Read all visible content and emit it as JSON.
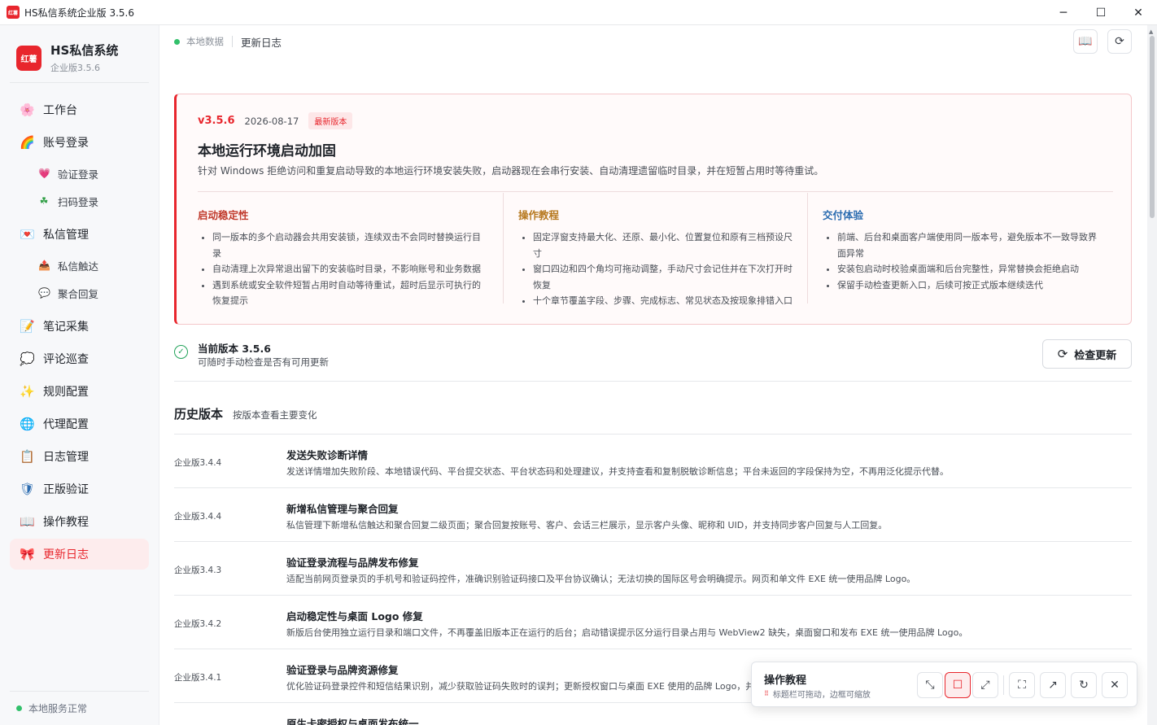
{
  "window": {
    "title": "HS私信系统企业版 3.5.6",
    "app_icon_text": "红薯",
    "minimize": "─",
    "maximize": "☐",
    "close": "✕"
  },
  "sidebar": {
    "brand_logo_text": "红薯",
    "brand_name": "HS私信系统",
    "brand_sub": "企业版3.5.6",
    "items": [
      {
        "label": "工作台",
        "icon": "🌸"
      },
      {
        "label": "账号登录",
        "icon": "🌈"
      },
      {
        "label": "验证登录",
        "icon": "💗"
      },
      {
        "label": "扫码登录",
        "icon": "☘"
      },
      {
        "label": "私信管理",
        "icon": "💌"
      },
      {
        "label": "私信触达",
        "icon": "📤"
      },
      {
        "label": "聚合回复",
        "icon": "💬"
      },
      {
        "label": "笔记采集",
        "icon": "📝"
      },
      {
        "label": "评论巡查",
        "icon": "💭"
      },
      {
        "label": "规则配置",
        "icon": "✨"
      },
      {
        "label": "代理配置",
        "icon": "🌐"
      },
      {
        "label": "日志管理",
        "icon": "📋"
      },
      {
        "label": "正版验证",
        "icon": "🛡"
      },
      {
        "label": "操作教程",
        "icon": "📖"
      },
      {
        "label": "更新日志",
        "icon": "🎀"
      }
    ],
    "footer_status": "本地服务正常"
  },
  "header": {
    "status": "本地数据",
    "breadcrumb": "更新日志",
    "btn_book_icon": "📖",
    "btn_refresh_icon": "⟳"
  },
  "release": {
    "version": "v3.5.6",
    "date": "2026-08-17",
    "badge": "最新版本",
    "title": "本地运行环境启动加固",
    "desc": "针对 Windows 拒绝访问和重复启动导致的本地运行环境安装失败，启动器现在会串行安装、自动清理遗留临时目录，并在短暂占用时等待重试。",
    "columns": [
      {
        "title": "启动稳定性",
        "color": "#c0392b",
        "items": [
          "同一版本的多个启动器会共用安装锁，连续双击不会同时替换运行目录",
          "自动清理上次异常退出留下的安装临时目录，不影响账号和业务数据",
          "遇到系统或安全软件短暂占用时自动等待重试，超时后显示可执行的恢复提示"
        ]
      },
      {
        "title": "操作教程",
        "color": "#b7791f",
        "items": [
          "固定浮窗支持最大化、还原、最小化、位置复位和原有三档预设尺寸",
          "窗口四边和四个角均可拖动调整，手动尺寸会记住并在下次打开时恢复",
          "十个章节覆盖字段、步骤、完成标志、常见状态及按现象排错入口"
        ]
      },
      {
        "title": "交付体验",
        "color": "#2b6cb0",
        "items": [
          "前端、后台和桌面客户端使用同一版本号，避免版本不一致导致界面异常",
          "安装包启动时校验桌面端和后台完整性，异常替换会拒绝启动",
          "保留手动检查更新入口，后续可按正式版本继续迭代"
        ]
      }
    ]
  },
  "current": {
    "title": "当前版本 3.5.6",
    "sub": "可随时手动检查是否有可用更新",
    "check_button": "检查更新",
    "check_icon": "⟳"
  },
  "history": {
    "title": "历史版本",
    "sub": "按版本查看主要变化",
    "rows": [
      {
        "version": "企业版3.4.4",
        "title": "发送失败诊断详情",
        "desc": "发送详情增加失败阶段、本地错误代码、平台提交状态、平台状态码和处理建议，并支持查看和复制脱敏诊断信息；平台未返回的字段保持为空，不再用泛化提示代替。"
      },
      {
        "version": "企业版3.4.4",
        "title": "新增私信管理与聚合回复",
        "desc": "私信管理下新增私信触达和聚合回复二级页面；聚合回复按账号、客户、会话三栏展示，显示客户头像、昵称和 UID，并支持同步客户回复与人工回复。"
      },
      {
        "version": "企业版3.4.3",
        "title": "验证登录流程与品牌发布修复",
        "desc": "适配当前网页登录页的手机号和验证码控件，准确识别验证码接口及平台协议确认；无法切换的国际区号会明确提示。网页和单文件 EXE 统一使用品牌 Logo。"
      },
      {
        "version": "企业版3.4.2",
        "title": "启动稳定性与桌面 Logo 修复",
        "desc": "新版后台使用独立运行目录和端口文件，不再覆盖旧版本正在运行的后台；启动错误提示区分运行目录占用与 WebView2 缺失，桌面窗口和发布 EXE 统一使用品牌 Logo。"
      },
      {
        "version": "企业版3.4.1",
        "title": "验证登录与品牌资源修复",
        "desc": "优化验证码登录控件和短信结果识别，减少获取验证码失败时的误判；更新授权窗口与桌面 EXE 使用的品牌 Logo，并"
      },
      {
        "version": "",
        "title": "原生卡密授权与桌面发布统一",
        "desc": ""
      }
    ]
  },
  "float": {
    "title": "操作教程",
    "sub": "标题栏可拖动，边框可缩放",
    "grip": "⠿"
  }
}
